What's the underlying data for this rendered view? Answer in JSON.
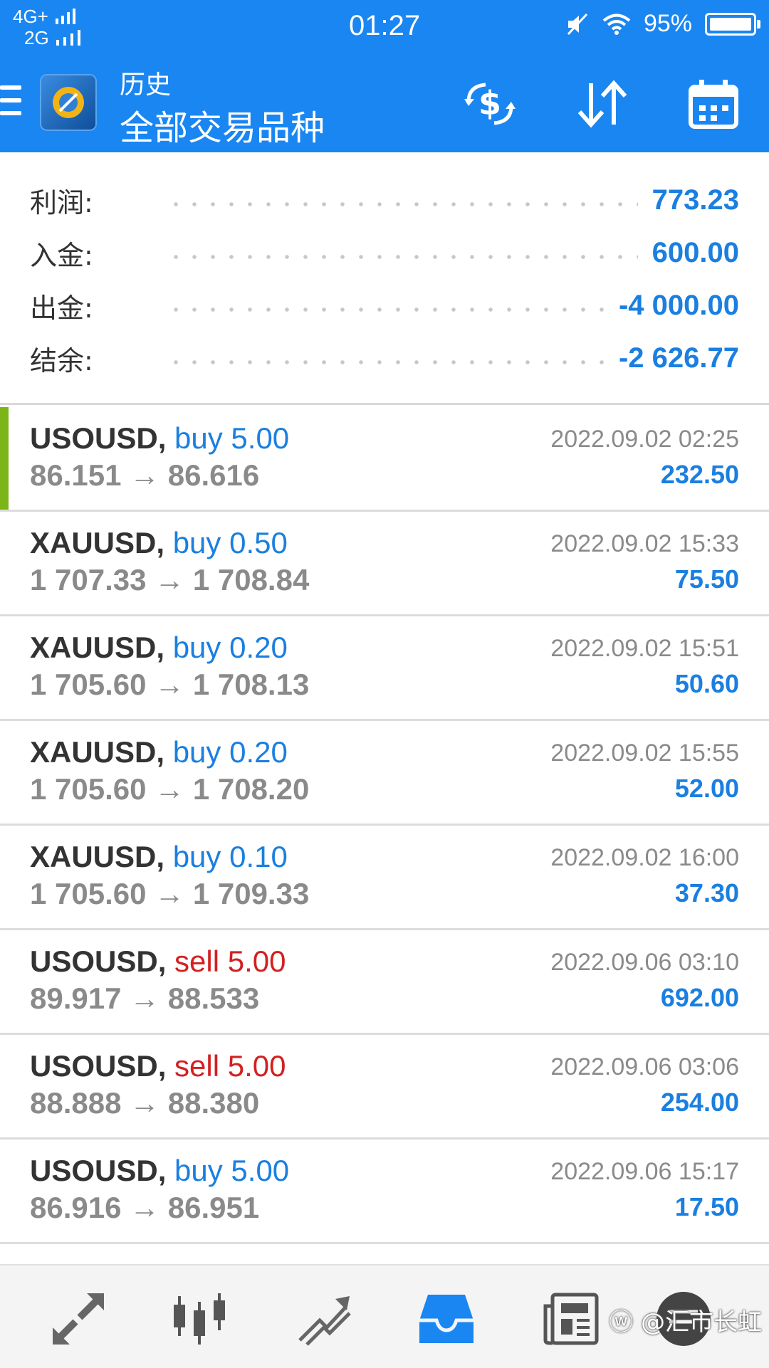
{
  "status_bar": {
    "network_1": "4G+",
    "network_2": "2G",
    "time": "01:27",
    "battery": "95%"
  },
  "header": {
    "subtitle": "历史",
    "title": "全部交易品种",
    "icons": [
      "currency-exchange-icon",
      "sort-icon",
      "calendar-icon"
    ]
  },
  "summary": {
    "profit_label": "利润:",
    "profit_value": "773.23",
    "deposit_label": "入金:",
    "deposit_value": "600.00",
    "withdrawal_label": "出金:",
    "withdrawal_value": "-4 000.00",
    "balance_label": "结余:",
    "balance_value": "-2 626.77"
  },
  "trades": [
    {
      "symbol": "USOUSD,",
      "side": "buy 5.00",
      "prices": "86.151 → 86.616",
      "time": "2022.09.02 02:25",
      "profit": "232.50"
    },
    {
      "symbol": "XAUUSD,",
      "side": "buy 0.50",
      "prices": "1 707.33 → 1 708.84",
      "time": "2022.09.02 15:33",
      "profit": "75.50"
    },
    {
      "symbol": "XAUUSD,",
      "side": "buy 0.20",
      "prices": "1 705.60 → 1 708.13",
      "time": "2022.09.02 15:51",
      "profit": "50.60"
    },
    {
      "symbol": "XAUUSD,",
      "side": "buy 0.20",
      "prices": "1 705.60 → 1 708.20",
      "time": "2022.09.02 15:55",
      "profit": "52.00"
    },
    {
      "symbol": "XAUUSD,",
      "side": "buy 0.10",
      "prices": "1 705.60 → 1 709.33",
      "time": "2022.09.02 16:00",
      "profit": "37.30"
    },
    {
      "symbol": "USOUSD,",
      "side": "sell 5.00",
      "prices": "89.917 → 88.533",
      "time": "2022.09.06 03:10",
      "profit": "692.00"
    },
    {
      "symbol": "USOUSD,",
      "side": "sell 5.00",
      "prices": "88.888 → 88.380",
      "time": "2022.09.06 03:06",
      "profit": "254.00"
    },
    {
      "symbol": "USOUSD,",
      "side": "buy 5.00",
      "prices": "86.916 → 86.951",
      "time": "2022.09.06 15:17",
      "profit": "17.50"
    }
  ],
  "bottom_nav": {
    "items": [
      "quotes-icon",
      "chart-icon",
      "trade-icon",
      "history-icon",
      "news-icon",
      "messages-icon"
    ],
    "active": "history-icon"
  },
  "watermark": "@汇市长虹",
  "colors": {
    "primary": "#1a86f2",
    "profit": "#1a7fe0",
    "sell": "#d32020",
    "selected_marker": "#7cb518"
  }
}
